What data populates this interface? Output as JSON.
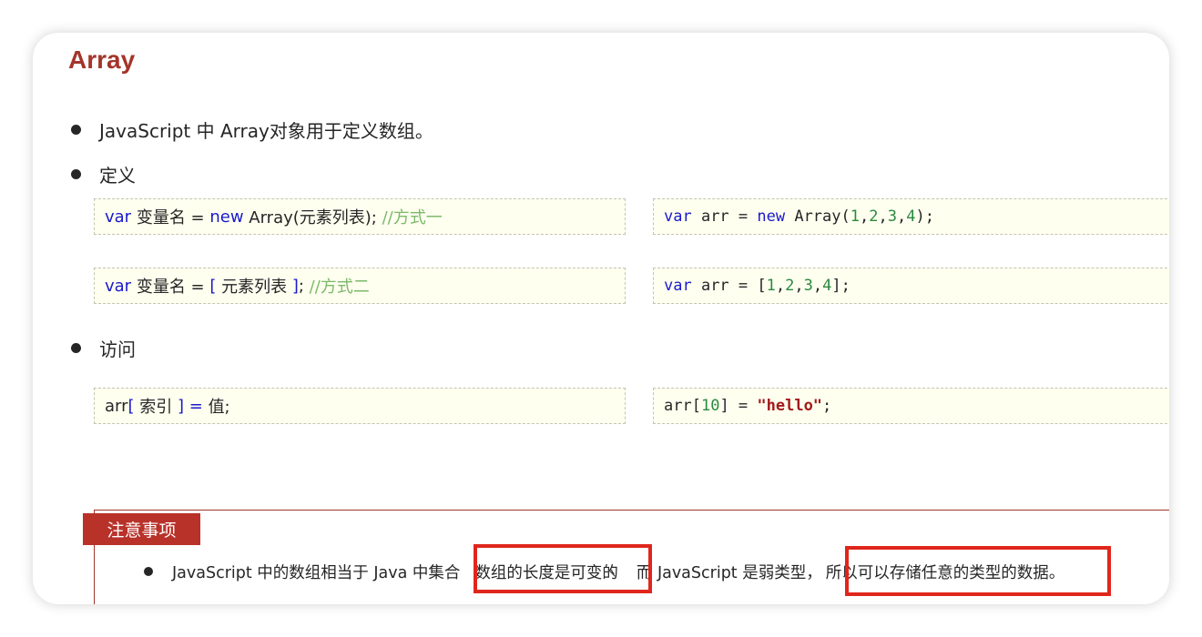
{
  "title": "Array",
  "bullets": {
    "intro": "JavaScript 中 Array对象用于定义数组。",
    "define": "定义",
    "access": "访问"
  },
  "code": {
    "def1": {
      "kw": "var",
      "name": " 变量名 = ",
      "new": "new",
      "call": " Array(元素列表); ",
      "comment": "//方式一"
    },
    "def1_example": {
      "kw": "var",
      "mid": " arr = ",
      "new": "new",
      "call_open": " Array(",
      "n1": "1",
      "c1": ",",
      "n2": "2",
      "c2": ",",
      "n3": "3",
      "c3": ",",
      "n4": "4",
      "close": ");"
    },
    "def2": {
      "kw": "var",
      "name": " 变量名 = ",
      "open": "[",
      "list": " 元素列表 ",
      "close": "]",
      "semi": "; ",
      "comment": "//方式二"
    },
    "def2_example": {
      "kw": "var",
      "mid": " arr = [",
      "n1": "1",
      "c1": ",",
      "n2": "2",
      "c2": ",",
      "n3": "3",
      "c3": ",",
      "n4": "4",
      "close": "];"
    },
    "access": {
      "arr": "arr",
      "open": "[",
      "index": " 索引 ",
      "close": "]",
      "eq": " = ",
      "val": "值;"
    },
    "access_example": {
      "arr": "arr[",
      "num": "10",
      "mid": "] = ",
      "str": "\"hello\"",
      "semi": ";"
    }
  },
  "note": {
    "tag": "注意事项",
    "part1": "JavaScript 中的数组相当于 Java 中集合",
    "part2": "数组的长度是可变的",
    "part3": "而 JavaScript 是弱类型，",
    "part4": "所以可以存储任意的类型的数据。"
  }
}
